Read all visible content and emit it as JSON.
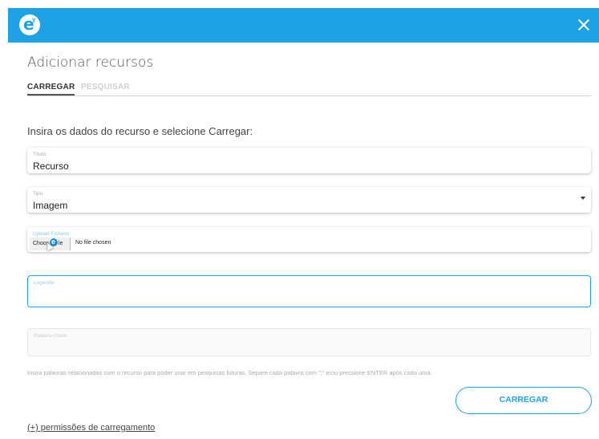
{
  "header": {
    "logo_letter": "e",
    "logo_accent": "y",
    "close_icon": "close-icon",
    "color": "#1ea2e6"
  },
  "page": {
    "title": "Adicionar recursos"
  },
  "tabs": [
    {
      "label": "CARREGAR",
      "active": true
    },
    {
      "label": "PESQUISAR",
      "active": false
    }
  ],
  "instruction": "Insira os dados do recurso e selecione Carregar:",
  "fields": {
    "titulo": {
      "label": "Título",
      "value": "Recurso"
    },
    "tipo": {
      "label": "Tipo",
      "value": "Imagem"
    },
    "upload": {
      "label": "Upload Ficheiro",
      "button": "Choose File",
      "status": "No file chosen"
    },
    "legenda": {
      "label": "Legenda",
      "value": ""
    },
    "palavra": {
      "label": "Palavra-chave",
      "value": ""
    }
  },
  "helper_text": "Insira palavras relacionadas com o recurso para poder usar em pesquisas futuras. Separe cada palavra com \";\" e/ou pressione ENTER após cada uma.",
  "actions": {
    "submit_label": "CARREGAR",
    "permissions_link": "(+) permissões de carregamento"
  },
  "cursor_badge": "e"
}
